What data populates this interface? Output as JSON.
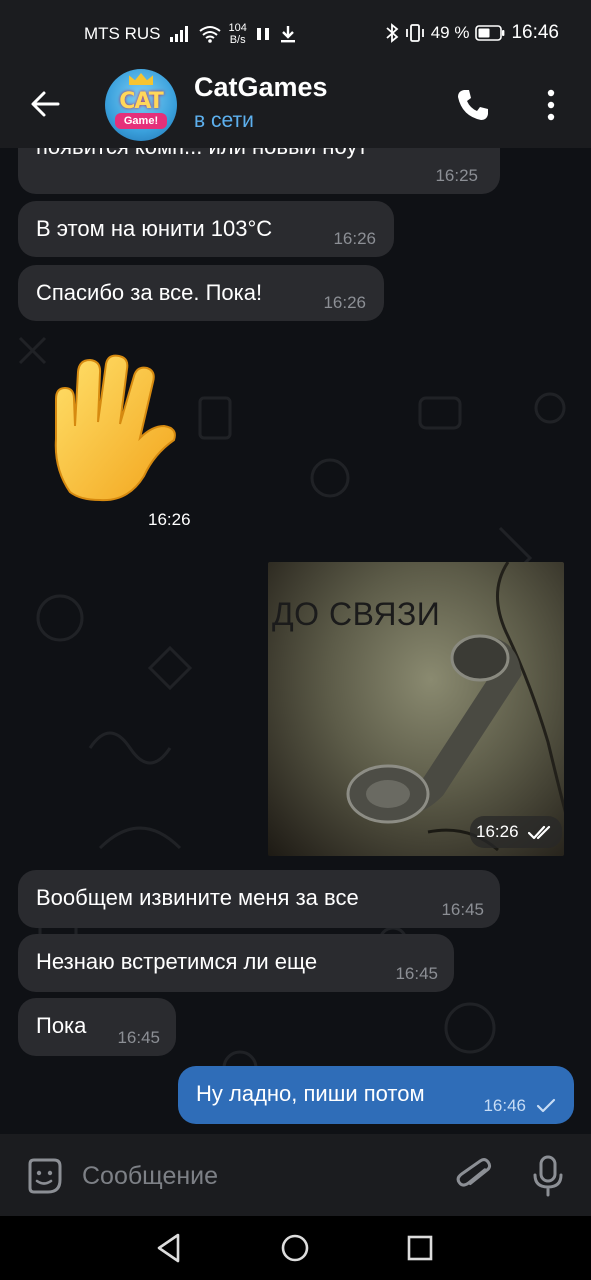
{
  "status_bar": {
    "carrier": "MTS RUS",
    "net_speed_value": "104",
    "net_speed_unit": "B/s",
    "battery_percent": "49 %",
    "time": "16:46",
    "icons": [
      "signal-icon",
      "wifi-icon",
      "pause-icon",
      "download-icon",
      "bluetooth-icon",
      "vibrate-icon",
      "battery-icon"
    ]
  },
  "header": {
    "chat_name": "CatGames",
    "status": "в сети",
    "avatar_text_top": "CAT",
    "avatar_text_bottom": "Game!"
  },
  "messages": [
    {
      "direction": "in",
      "text": "появится комп... или новый ноут",
      "time": "16:25",
      "truncated_top": true
    },
    {
      "direction": "in",
      "text": "В этом на юнити 103°C",
      "time": "16:26"
    },
    {
      "direction": "in",
      "text": "Спасибо за все. Пока!",
      "time": "16:26"
    },
    {
      "direction": "in",
      "type": "sticker",
      "sticker": "raised-hand-emoji",
      "time": "16:26"
    },
    {
      "direction": "out",
      "type": "photo",
      "caption": "ДО СВЯЗИ",
      "time": "16:26",
      "read": true
    },
    {
      "direction": "in",
      "text": "Вообщем извините меня за все",
      "time": "16:45"
    },
    {
      "direction": "in",
      "text": "Незнаю встретимся ли еще",
      "time": "16:45"
    },
    {
      "direction": "in",
      "text": "Пока",
      "time": "16:45"
    },
    {
      "direction": "out",
      "text": "Ну ладно, пиши потом",
      "time": "16:46",
      "read": false
    }
  ],
  "composer": {
    "placeholder": "Сообщение"
  },
  "colors": {
    "accent": "#5db0ee",
    "incoming_bubble": "#2a2b2f",
    "outgoing_bubble": "#2f6db8",
    "background": "#0f1115"
  }
}
